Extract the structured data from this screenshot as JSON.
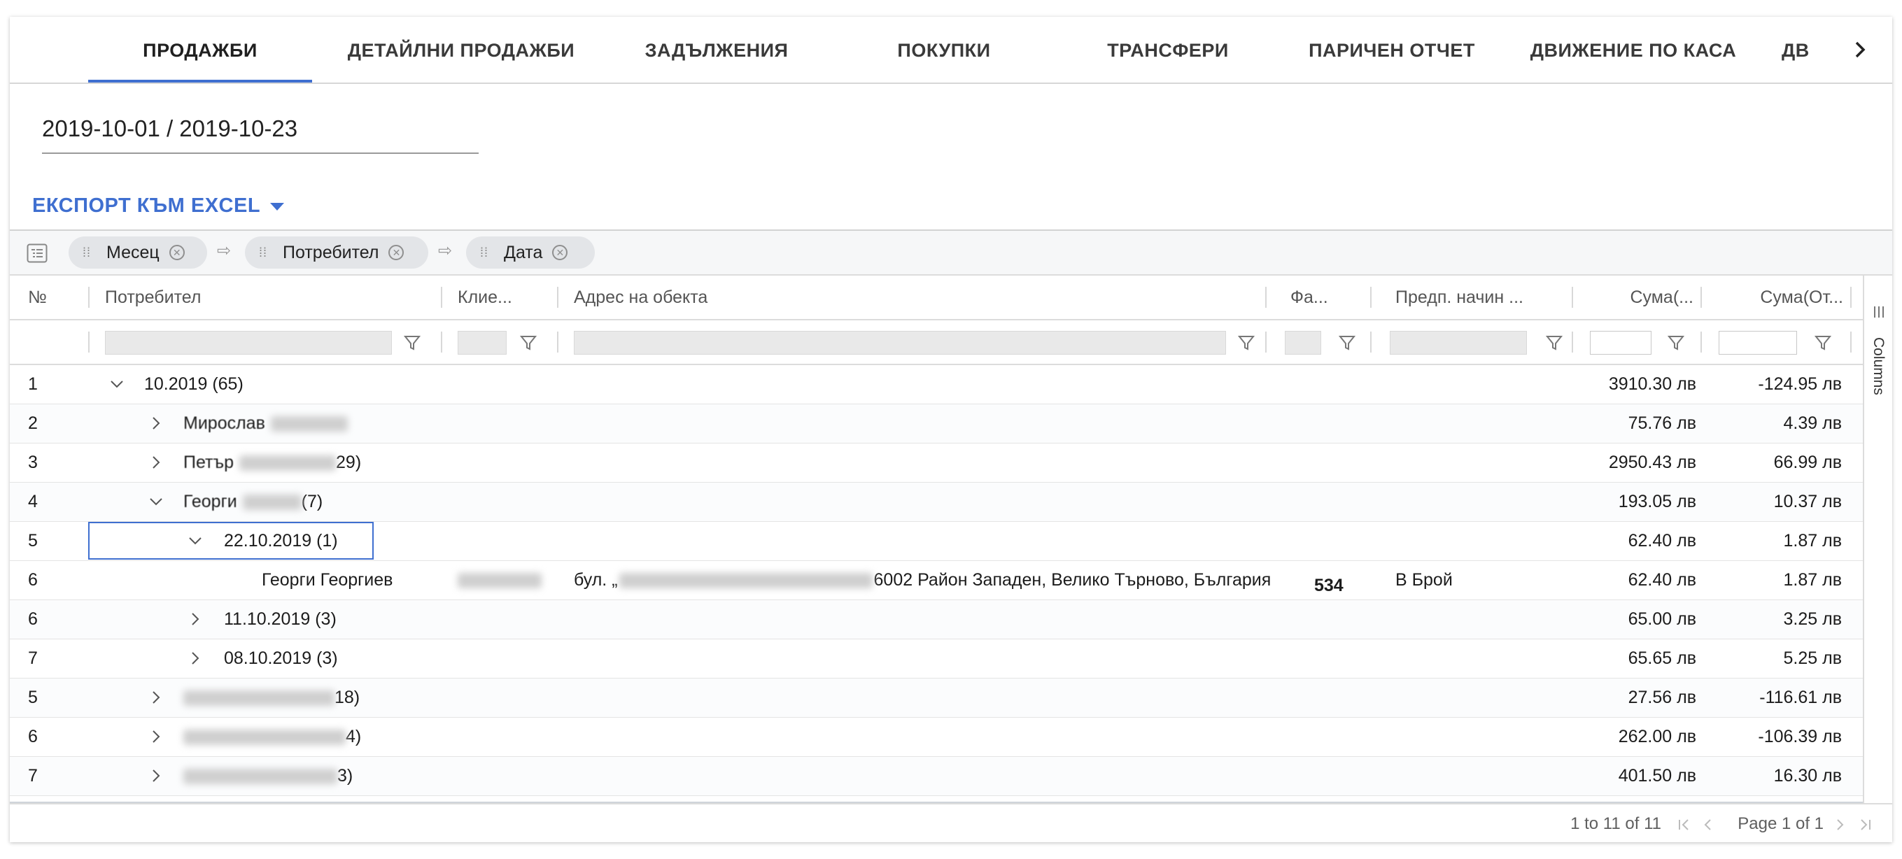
{
  "tabs": [
    {
      "label": "ПРОДАЖБИ",
      "active": true
    },
    {
      "label": "ДЕТАЙЛНИ ПРОДАЖБИ"
    },
    {
      "label": "ЗАДЪЛЖЕНИЯ"
    },
    {
      "label": "ПОКУПКИ"
    },
    {
      "label": "ТРАНСФЕРИ"
    },
    {
      "label": "ПАРИЧЕН ОТЧЕТ"
    },
    {
      "label": "ДВИЖЕНИЕ ПО КАСА"
    },
    {
      "label": "ДВ"
    }
  ],
  "date_range": "2019-10-01 / 2019-10-23",
  "export_label": "ЕКСПОРТ КЪМ EXCEL",
  "group_chips": [
    "Месец",
    "Потребител",
    "Дата"
  ],
  "columns": {
    "no": "№",
    "user": "Потребител",
    "client": "Клие...",
    "address": "Адрес на обекта",
    "invoice": "Фа...",
    "payment": "Предп. начин ...",
    "sum1": "Сума(...",
    "sum2": "Сума(От..."
  },
  "side_panel": "Columns",
  "rows": [
    {
      "n": "1",
      "label": "10.2019 (65)",
      "s1": "3910.30 лв",
      "s2": "-124.95 лв"
    },
    {
      "n": "2",
      "label_prefix": "Мирослав",
      "label_suffix": "",
      "s1": "75.76 лв",
      "s2": "4.39 лв"
    },
    {
      "n": "3",
      "label_prefix": "Петър",
      "label_suffix": "29)",
      "s1": "2950.43 лв",
      "s2": "66.99 лв"
    },
    {
      "n": "4",
      "label_prefix": "Георги",
      "label_suffix": "(7)",
      "s1": "193.05 лв",
      "s2": "10.37 лв"
    },
    {
      "n": "5",
      "label": "22.10.2019 (1)",
      "s1": "62.40 лв",
      "s2": "1.87 лв"
    },
    {
      "n": "6",
      "user": "Георги Георгиев",
      "address_prefix": "бул. „",
      "address_suffix": "6002 Район Западен, Велико Търново, България",
      "invoice": "534",
      "payment": "В Брой",
      "s1": "62.40 лв",
      "s2": "1.87 лв"
    },
    {
      "n": "6",
      "label": "11.10.2019 (3)",
      "s1": "65.00 лв",
      "s2": "3.25 лв"
    },
    {
      "n": "7",
      "label": "08.10.2019 (3)",
      "s1": "65.65 лв",
      "s2": "5.25 лв"
    },
    {
      "n": "5",
      "label_suffix": "18)",
      "s1": "27.56 лв",
      "s2": "-116.61 лв"
    },
    {
      "n": "6",
      "label_suffix": "4)",
      "s1": "262.00 лв",
      "s2": "-106.39 лв"
    },
    {
      "n": "7",
      "label_suffix": "3)",
      "s1": "401.50 лв",
      "s2": "16.30 лв"
    }
  ],
  "paging": {
    "summary": "1 to 11 of 11",
    "page": "Page 1 of 1"
  }
}
